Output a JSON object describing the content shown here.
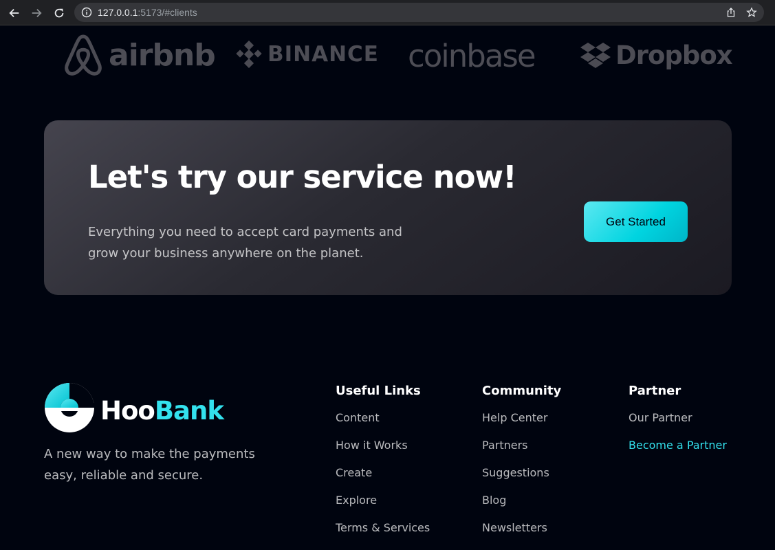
{
  "browser": {
    "url_host": "127.0.0.1",
    "url_rest": ":5173/#clients"
  },
  "clients": [
    {
      "name": "airbnb",
      "icon": "airbnb-logo-icon"
    },
    {
      "name": "BINANCE",
      "icon": "binance-logo-icon"
    },
    {
      "name": "coinbase",
      "icon": ""
    },
    {
      "name": "Dropbox",
      "icon": "dropbox-logo-icon"
    }
  ],
  "cta": {
    "title": "Let's try our service now!",
    "description": "Everything you need to accept card payments and grow your business anywhere on the planet.",
    "button_label": "Get Started"
  },
  "footer": {
    "brand_hoo": "Hoo",
    "brand_bank": "Bank",
    "tagline": "A new way to make the payments easy, reliable and secure.",
    "columns": [
      {
        "title": "Useful Links",
        "links": [
          "Content",
          "How it Works",
          "Create",
          "Explore",
          "Terms & Services"
        ]
      },
      {
        "title": "Community",
        "links": [
          "Help Center",
          "Partners",
          "Suggestions",
          "Blog",
          "Newsletters"
        ]
      },
      {
        "title": "Partner",
        "links": [
          "Our Partner",
          "Become a Partner"
        ]
      }
    ],
    "active_link": "Become a Partner"
  },
  "colors": {
    "background": "#00040f",
    "accent": "#33e2ee",
    "card": "#2a2a32"
  }
}
